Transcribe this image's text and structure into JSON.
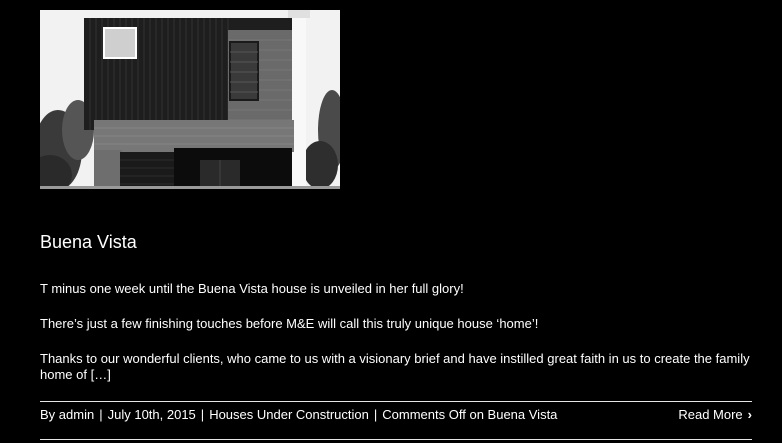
{
  "post": {
    "image_alt": "Buena Vista house photo",
    "title": "Buena Vista",
    "paragraphs": [
      "T minus one week until the Buena Vista house is unveiled in her full glory!",
      "There’s just a few finishing touches before M&E will call this truly unique house ‘home’!",
      "Thanks to our wonderful clients, who came to us with a visionary brief and have instilled great faith in us to create the family home of […]"
    ],
    "meta": {
      "by_prefix": "By",
      "author": "admin",
      "separator": "|",
      "date": "July 10th, 2015",
      "category": "Houses Under Construction",
      "comments": "Comments Off",
      "comments_suffix": "on Buena Vista"
    },
    "read_more": {
      "label": "Read More",
      "icon": "chevron-right-icon"
    }
  },
  "colors": {
    "background": "#000000",
    "text": "#ffffff",
    "divider": "#e6e6e6"
  }
}
